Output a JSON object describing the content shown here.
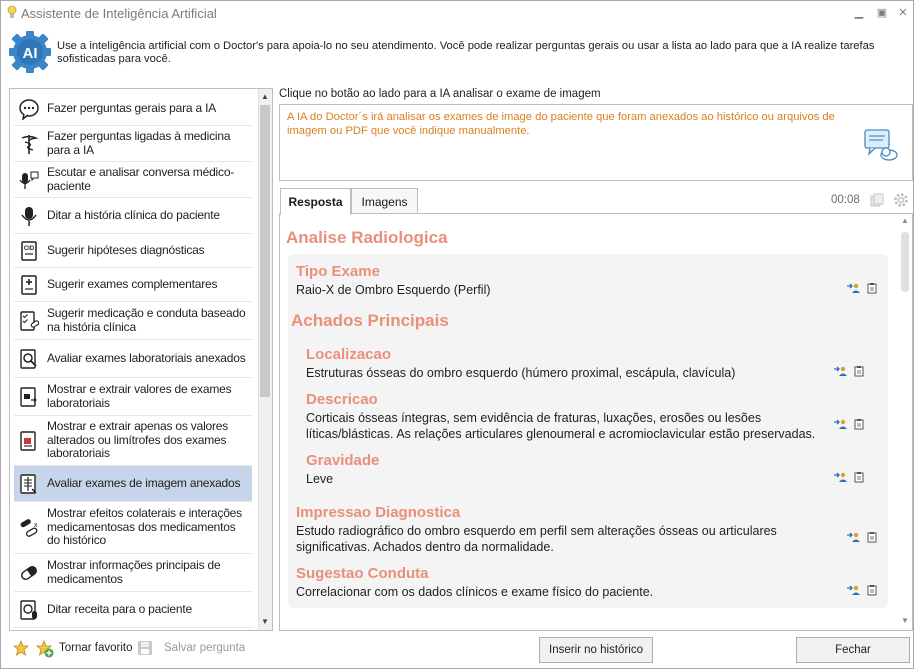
{
  "window": {
    "title": "Assistente de Inteligência Artificial",
    "controls": [
      "minimize",
      "maximize",
      "close"
    ]
  },
  "header": {
    "badge": "AI",
    "intro": "Use a inteligência artificial com o Doctor's para apoia-lo no seu atendimento. Você pode realizar perguntas gerais ou usar a lista ao lado para que a IA realize tarefas sofisticadas para você."
  },
  "sidebar": {
    "selected_index": 10,
    "items": [
      {
        "label": "Fazer perguntas gerais para a IA",
        "icon": "chat-bubble-icon"
      },
      {
        "label": "Fazer perguntas ligadas à medicina para a IA",
        "icon": "caduceus-icon"
      },
      {
        "label": "Escutar e analisar conversa médico-paciente",
        "icon": "mic-chat-icon"
      },
      {
        "label": "Ditar a história clínica do paciente",
        "icon": "microphone-icon"
      },
      {
        "label": "Sugerir hipóteses diagnósticas",
        "icon": "cid-document-icon"
      },
      {
        "label": "Sugerir exames complementares",
        "icon": "plus-document-icon"
      },
      {
        "label": "Sugerir medicação e conduta baseado na história clínica",
        "icon": "checklist-pill-icon"
      },
      {
        "label": "Avaliar exames laboratoriais anexados",
        "icon": "magnify-document-icon"
      },
      {
        "label": "Mostrar e extrair valores de exames laboratoriais",
        "icon": "extract-document-icon"
      },
      {
        "label": "Mostrar e extrair apenas os valores alterados ou limítrofes dos exames laboratoriais",
        "icon": "alert-document-icon"
      },
      {
        "label": "Avaliar exames de imagem anexados",
        "icon": "xray-document-icon"
      },
      {
        "label": "Mostrar efeitos colaterais e interações medicamentosas dos medicamentos do histórico",
        "icon": "pills-interaction-icon"
      },
      {
        "label": "Mostrar informações principais de medicamentos",
        "icon": "pill-icon"
      },
      {
        "label": "Ditar receita para o paciente",
        "icon": "prescription-mic-icon"
      }
    ]
  },
  "prompt": {
    "hint": "Clique no botão ao lado para a IA analisar o exame de imagem",
    "info": "A IA do Doctor´s irá analisar os exames de image do paciente que foram anexados ao histórico ou arquivos de imagem ou PDF que você indique manualmente."
  },
  "tabs": [
    {
      "label": "Resposta",
      "active": true
    },
    {
      "label": "Imagens",
      "active": false
    }
  ],
  "timer": "00:08",
  "result": {
    "title": "Analise Radiologica",
    "tipo_exame": {
      "heading": "Tipo Exame",
      "text": "Raio-X de Ombro Esquerdo (Perfil)"
    },
    "achados_heading": "Achados Principais",
    "localizacao": {
      "heading": "Localizacao",
      "text": "Estruturas ósseas do ombro esquerdo (húmero proximal, escápula, clavícula)"
    },
    "descricao": {
      "heading": "Descricao",
      "line1": "Corticais ósseas íntegras, sem evidência de fraturas, luxações, erosões ou lesões",
      "line2": "líticas/blásticas. As relações articulares glenoumeral e acromioclavicular estão preservadas."
    },
    "gravidade": {
      "heading": "Gravidade",
      "text": "Leve"
    },
    "impressao": {
      "heading": "Impressao Diagnostica",
      "line1": "Estudo radiográfico do ombro esquerdo em perfil sem alterações ósseas ou articulares",
      "line2": "significativas. Achados dentro da normalidade."
    },
    "sugestao": {
      "heading": "Sugestao Conduta",
      "text": "Correlacionar com os dados clínicos e exame físico do paciente."
    }
  },
  "footer": {
    "favorite_label": "Tornar favorito",
    "save_label": "Salvar pergunta",
    "insert_button": "Inserir no histórico",
    "close_button": "Fechar"
  },
  "colors": {
    "heading": "#e8907a",
    "info_text": "#d98020",
    "selection": "#c6d5ea",
    "badge": "#3a86c8"
  }
}
